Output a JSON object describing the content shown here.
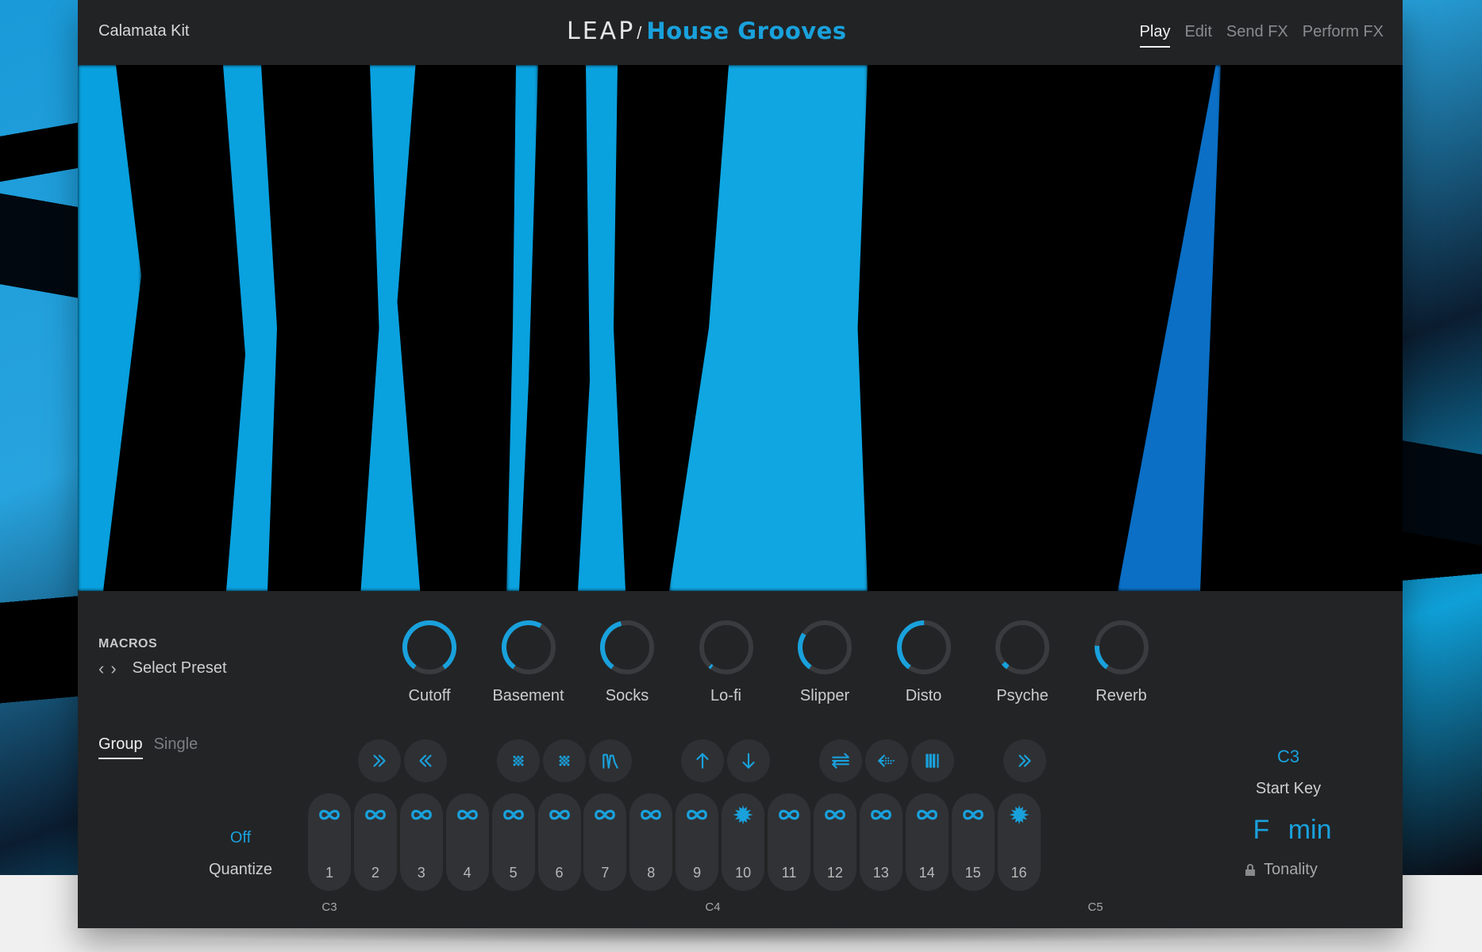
{
  "header": {
    "kit_name": "Calamata Kit",
    "logo": {
      "brand": "LEAP",
      "product": "House Grooves"
    },
    "tabs": [
      {
        "label": "Play",
        "active": true
      },
      {
        "label": "Edit",
        "active": false
      },
      {
        "label": "Send FX",
        "active": false
      },
      {
        "label": "Perform FX",
        "active": false
      }
    ]
  },
  "macros": {
    "title": "MACROS",
    "preset_label": "Select Preset",
    "knobs": [
      {
        "label": "Cutoff",
        "value": 1.0
      },
      {
        "label": "Basement",
        "value": 0.6
      },
      {
        "label": "Socks",
        "value": 0.45
      },
      {
        "label": "Lo-fi",
        "value": 0.02
      },
      {
        "label": "Slipper",
        "value": 0.3
      },
      {
        "label": "Disto",
        "value": 0.5
      },
      {
        "label": "Psyche",
        "value": 0.05
      },
      {
        "label": "Reverb",
        "value": 0.2
      }
    ]
  },
  "mode": {
    "options": [
      {
        "label": "Group",
        "active": true
      },
      {
        "label": "Single",
        "active": false
      }
    ]
  },
  "quantize": {
    "value": "Off",
    "label": "Quantize"
  },
  "perform_buttons": [
    {
      "icon": "double-chevron-right-icon"
    },
    {
      "icon": "double-chevron-left-icon"
    },
    {
      "icon": "grid-diamond-icon"
    },
    {
      "icon": "grid-diamond-alt-icon"
    },
    {
      "icon": "filter-wave-icon"
    },
    {
      "icon": "arrow-up-icon"
    },
    {
      "icon": "arrow-down-icon"
    },
    {
      "icon": "swap-arrows-icon"
    },
    {
      "icon": "scatter-left-icon"
    },
    {
      "icon": "stutter-bars-icon"
    },
    {
      "icon": "double-chevron-right-icon"
    }
  ],
  "pads": [
    {
      "number": "1",
      "icon": "loop-icon"
    },
    {
      "number": "2",
      "icon": "loop-icon"
    },
    {
      "number": "3",
      "icon": "loop-icon"
    },
    {
      "number": "4",
      "icon": "loop-icon"
    },
    {
      "number": "5",
      "icon": "loop-icon"
    },
    {
      "number": "6",
      "icon": "loop-icon"
    },
    {
      "number": "7",
      "icon": "loop-icon"
    },
    {
      "number": "8",
      "icon": "loop-icon"
    },
    {
      "number": "9",
      "icon": "loop-icon"
    },
    {
      "number": "10",
      "icon": "one-shot-icon"
    },
    {
      "number": "11",
      "icon": "loop-icon"
    },
    {
      "number": "12",
      "icon": "loop-icon"
    },
    {
      "number": "13",
      "icon": "loop-icon"
    },
    {
      "number": "14",
      "icon": "loop-icon"
    },
    {
      "number": "15",
      "icon": "loop-icon"
    },
    {
      "number": "16",
      "icon": "one-shot-icon"
    }
  ],
  "note_labels": [
    "C3",
    "C4",
    "C5"
  ],
  "start_key": {
    "value": "C3",
    "label": "Start Key"
  },
  "tonality": {
    "value": "F min",
    "label": "Tonality",
    "icon": "lock-icon"
  },
  "colors": {
    "accent": "#19a1dc",
    "panel": "#232426",
    "pad": "#313235"
  }
}
